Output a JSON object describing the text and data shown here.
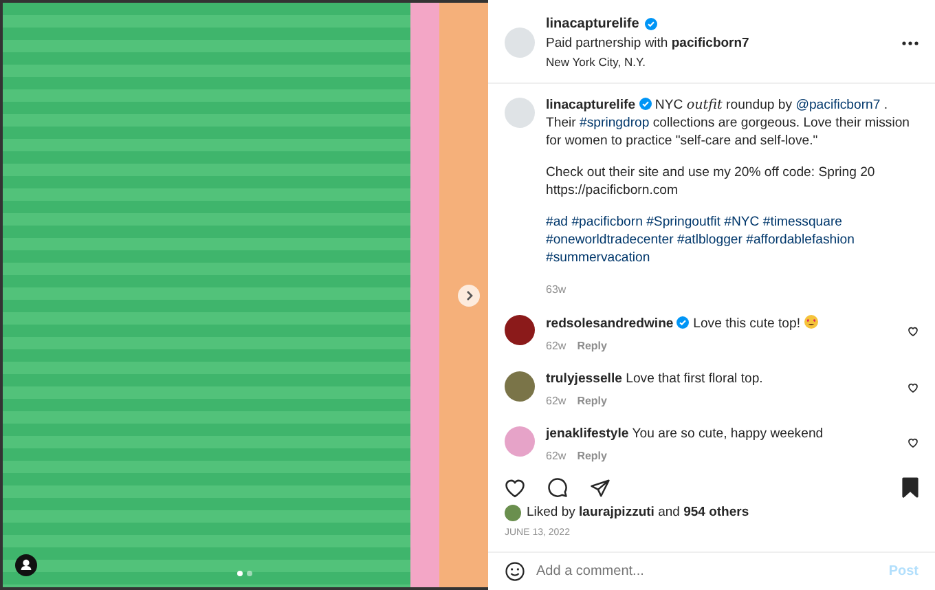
{
  "photo": {
    "carousel_dots": [
      {
        "selected": true
      },
      {
        "selected": false
      }
    ]
  },
  "header": {
    "username": "linacapturelife",
    "verified": true,
    "partnership_prefix": "Paid partnership with",
    "partner": "pacificborn7",
    "location": "New York City, N.Y."
  },
  "caption": {
    "username": "linacapturelife",
    "verified": true,
    "time": "63w",
    "paragraphs": [
      [
        {
          "kind": "text",
          "text": "NYC "
        },
        {
          "kind": "script",
          "text": "outfit"
        },
        {
          "kind": "text",
          "text": " roundup by "
        },
        {
          "kind": "link",
          "text": "@pacificborn7"
        },
        {
          "kind": "text",
          "text": " . Their "
        },
        {
          "kind": "link",
          "text": "#springdrop"
        },
        {
          "kind": "text",
          "text": " collections are gorgeous. Love their mission for women to practice \"self-care and self-love.\""
        }
      ],
      [
        {
          "kind": "text",
          "text": "Check out their site and use my 20% off code: Spring 20"
        },
        {
          "kind": "newline"
        },
        {
          "kind": "text",
          "text": "https://pacificborn.com"
        }
      ],
      [
        {
          "kind": "link",
          "text": "#ad"
        },
        {
          "kind": "link",
          "text": "#pacificborn"
        },
        {
          "kind": "link",
          "text": "#Springoutfit"
        },
        {
          "kind": "link",
          "text": "#NYC"
        },
        {
          "kind": "link",
          "text": "#timessquare"
        },
        {
          "kind": "link",
          "text": "#oneworldtradecenter"
        },
        {
          "kind": "link",
          "text": "#atlblogger"
        },
        {
          "kind": "link",
          "text": "#affordablefashion"
        },
        {
          "kind": "link",
          "text": "#summervacation"
        }
      ]
    ]
  },
  "comments": [
    {
      "username": "redsolesandredwine",
      "verified": true,
      "text": "Love this cute top!",
      "time": "62w",
      "reply": "Reply",
      "color": "#8b1a1a"
    },
    {
      "username": "trulyjesselle",
      "verified": false,
      "text": "Love that first floral top.",
      "time": "62w",
      "reply": "Reply",
      "color": "#7a7448"
    },
    {
      "username": "jenaklifestyle",
      "verified": false,
      "text": "You are so cute, happy weekend",
      "time": "62w",
      "reply": "Reply",
      "color": "#e6a3c8"
    }
  ],
  "actions": {
    "liked": false,
    "saved": true
  },
  "likes": {
    "prefix": "Liked by",
    "user": "laurajpizzuti",
    "middle": "and",
    "count": "954 others"
  },
  "date": "JUNE 13, 2022",
  "comment_box": {
    "placeholder": "Add a comment...",
    "post": "Post",
    "post_disabled": true
  }
}
